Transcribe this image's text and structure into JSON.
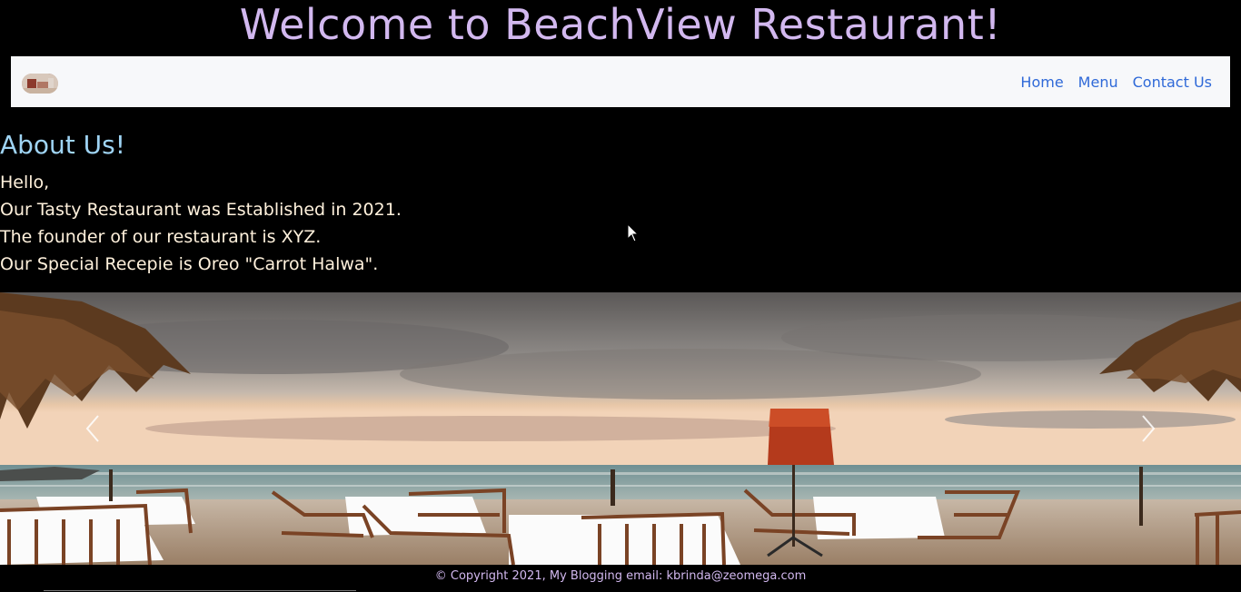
{
  "header": {
    "title": "Welcome to BeachView Restaurant!"
  },
  "navbar": {
    "logo_icon": "restaurant-logo",
    "links": [
      {
        "label": "Home"
      },
      {
        "label": "Menu"
      },
      {
        "label": "Contact Us"
      }
    ]
  },
  "about": {
    "heading": "About Us!",
    "lines": [
      "Hello,",
      "Our Tasty Restaurant was Established in 2021.",
      "The founder of our restaurant is XYZ.",
      "Our Special Recepie is Oreo \"Carrot Halwa\"."
    ]
  },
  "carousel": {
    "image": "beach-restaurant-sunset",
    "prev_icon": "chevron-left-icon",
    "next_icon": "chevron-right-icon"
  },
  "footer": {
    "text": "© Copyright 2021, My Blogging email: kbrinda@zeomega.com"
  },
  "colors": {
    "title": "#d2b8ef",
    "nav_bg": "#f7f8fa",
    "nav_link": "#2f69d8",
    "about_heading": "#9fd4f4",
    "about_text": "#fff1dc",
    "footer_text": "#d2b8ef",
    "page_bg": "#000000"
  }
}
